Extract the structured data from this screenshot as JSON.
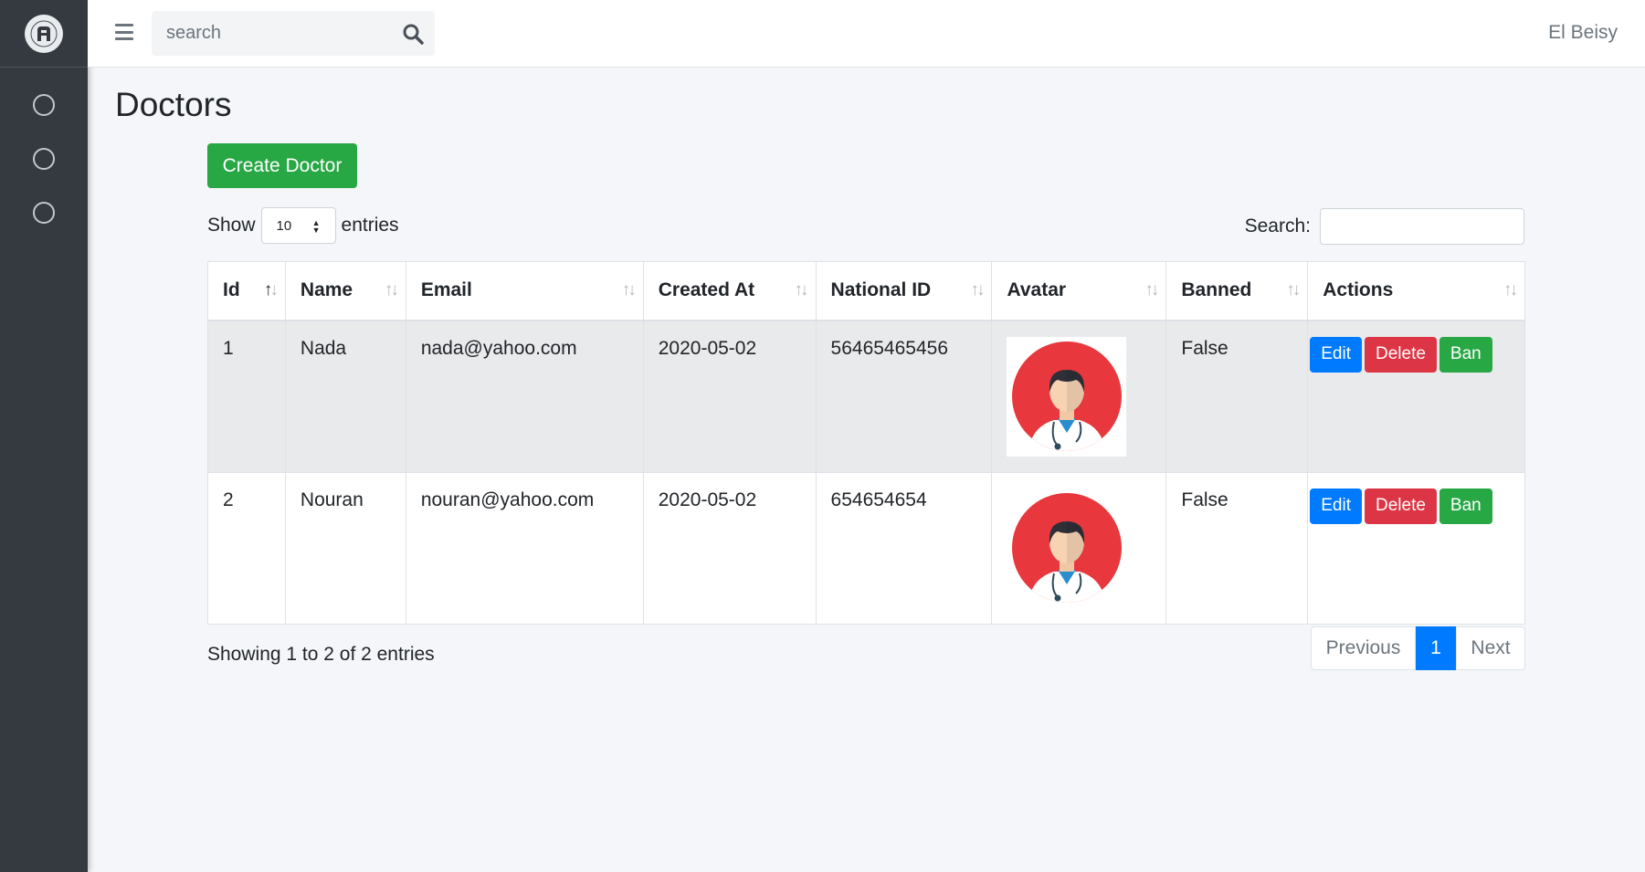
{
  "sidebar": {
    "logo_icon": "brand-logo-icon",
    "items": [
      {
        "icon": "circle-icon"
      },
      {
        "icon": "circle-icon"
      },
      {
        "icon": "circle-icon"
      }
    ]
  },
  "topbar": {
    "search_placeholder": "search",
    "user_name": "El Beisy"
  },
  "page": {
    "title": "Doctors",
    "create_label": "Create Doctor"
  },
  "datatable": {
    "show_label": "Show",
    "page_length": "10",
    "entries_label": "entries",
    "search_label": "Search:",
    "columns": [
      "Id",
      "Name",
      "Email",
      "Created At",
      "National ID",
      "Avatar",
      "Banned",
      "Actions"
    ],
    "rows": [
      {
        "id": "1",
        "name": "Nada",
        "email": "nada@yahoo.com",
        "created_at": "2020-05-02",
        "national_id": "56465465456",
        "banned": "False"
      },
      {
        "id": "2",
        "name": "Nouran",
        "email": "nouran@yahoo.com",
        "created_at": "2020-05-02",
        "national_id": "654654654",
        "banned": "False"
      }
    ],
    "actions": {
      "edit": "Edit",
      "delete": "Delete",
      "ban": "Ban"
    },
    "info": "Showing 1 to 2 of 2 entries",
    "pagination": {
      "previous": "Previous",
      "current": "1",
      "next": "Next"
    }
  },
  "colors": {
    "sidebar_bg": "#343a40",
    "primary": "#007bff",
    "success": "#28a745",
    "danger": "#dc3545",
    "avatar_red": "#e8383d"
  }
}
